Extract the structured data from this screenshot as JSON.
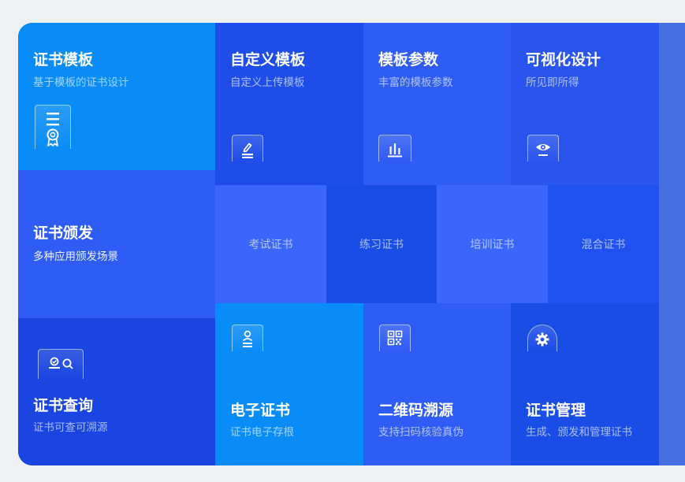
{
  "colors": {
    "sky": "#0a8cf8",
    "royal": "#1e4de9",
    "medium": "#2f5cf5",
    "light": "#3a66fc",
    "dark": "#1a45e0",
    "side": "#4670e2",
    "background": "#eef0f4"
  },
  "template_tile": {
    "title": "证书模板",
    "subtitle": "基于模板的证书设计",
    "icon": "certificate-ribbon-icon"
  },
  "custom_tile": {
    "title": "自定义模板",
    "subtitle": "自定义上传模板",
    "icon": "edit-icon"
  },
  "params_tile": {
    "title": "模板参数",
    "subtitle": "丰富的模板参数",
    "icon": "bar-chart-icon"
  },
  "visual_tile": {
    "title": "可视化设计",
    "subtitle": "所见即所得",
    "icon": "eye-icon"
  },
  "issue_tile": {
    "title": "证书颁发",
    "subtitle": "多种应用颁发场景"
  },
  "issue_types": [
    {
      "label": "考试证书"
    },
    {
      "label": "练习证书"
    },
    {
      "label": "培训证书"
    },
    {
      "label": "混合证书"
    }
  ],
  "query_tile": {
    "title": "证书查询",
    "subtitle": "证书可查可溯源",
    "icon": "certificate-search-icon"
  },
  "ecert_tile": {
    "title": "电子证书",
    "subtitle": "证书电子存根",
    "icon": "person-document-icon"
  },
  "qr_tile": {
    "title": "二维码溯源",
    "subtitle": "支持扫码核验真伪",
    "icon": "qr-code-icon"
  },
  "manage_tile": {
    "title": "证书管理",
    "subtitle": "生成、颁发和管理证书",
    "icon": "gear-icon"
  }
}
